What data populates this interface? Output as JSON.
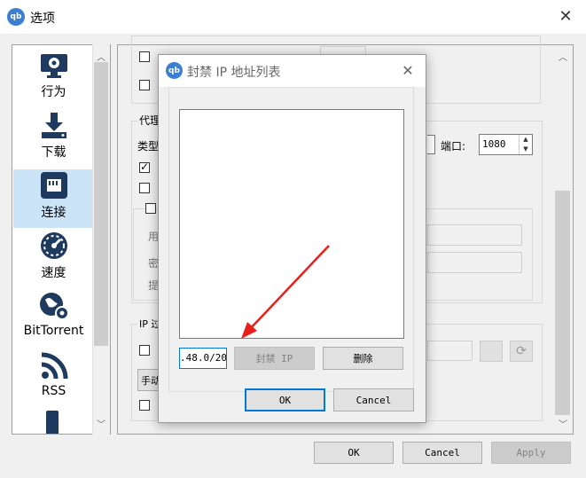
{
  "window": {
    "title": "选项",
    "app_icon": "qb"
  },
  "sidebar": {
    "items": [
      {
        "label": "行为",
        "icon": "monitor-gear-icon"
      },
      {
        "label": "下载",
        "icon": "download-icon"
      },
      {
        "label": "连接",
        "icon": "network-icon",
        "selected": true
      },
      {
        "label": "速度",
        "icon": "speedometer-icon"
      },
      {
        "label": "BitTorrent",
        "icon": "globe-gear-icon"
      },
      {
        "label": "RSS",
        "icon": "rss-icon"
      }
    ]
  },
  "proxy": {
    "group_label": "代理",
    "type_label": "类型",
    "port_label": "端口:",
    "port_value": "1080",
    "user_label": "用",
    "pass_label": "密",
    "hint_label": "提"
  },
  "ip_filter": {
    "group_label": "IP 过",
    "manual_label": "手动"
  },
  "buttons": {
    "ok": "OK",
    "cancel": "Cancel",
    "apply": "Apply"
  },
  "dialog": {
    "title": "封禁 IP 地址列表",
    "icon": "qb",
    "input_value": ".48.0/20",
    "ban_label": "封禁 IP",
    "delete_label": "删除",
    "ok": "OK",
    "cancel": "Cancel"
  },
  "colors": {
    "accent": "#0078d7",
    "annotation_arrow": "#e8201c",
    "selection": "#cce4f7"
  }
}
